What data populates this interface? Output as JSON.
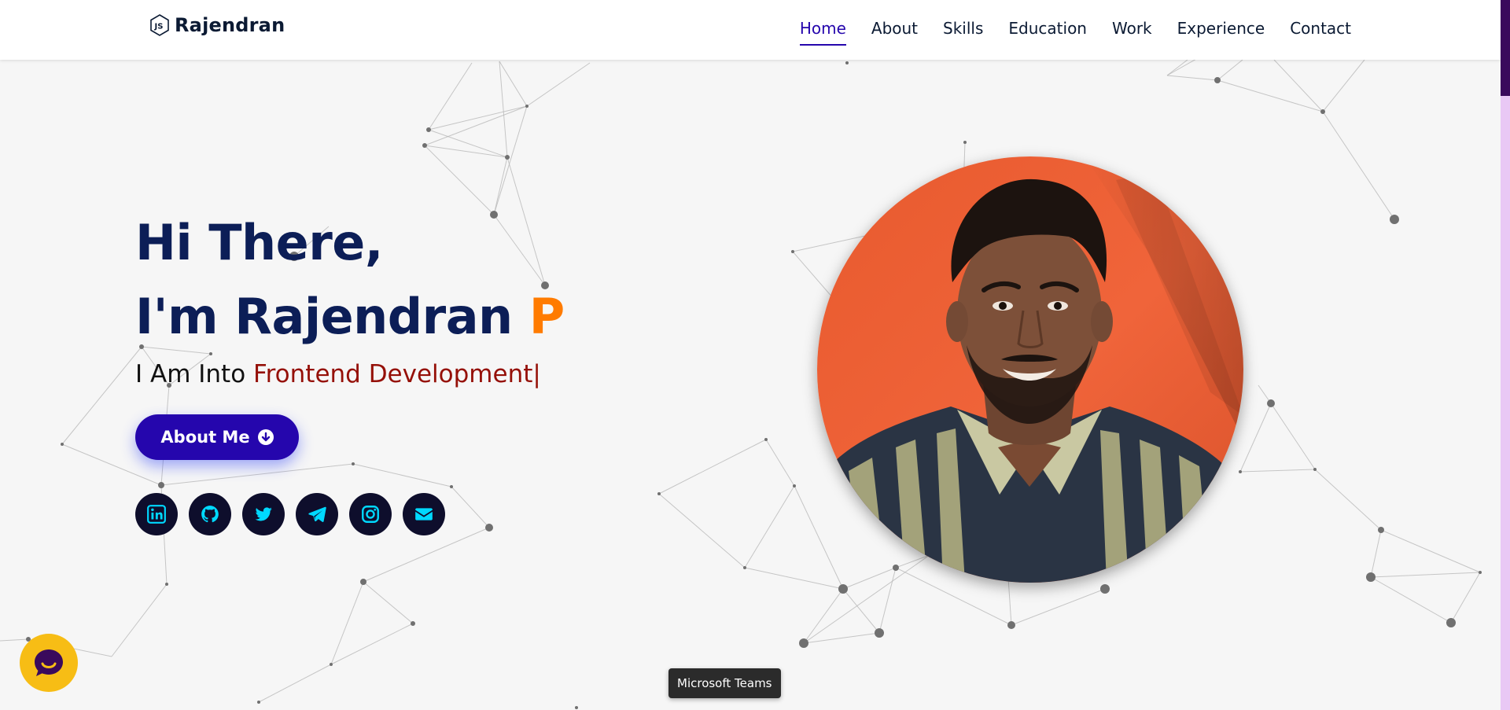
{
  "brand": {
    "name": "Rajendran",
    "icon": "node-js-icon"
  },
  "nav": {
    "items": [
      {
        "label": "Home",
        "active": true
      },
      {
        "label": "About",
        "active": false
      },
      {
        "label": "Skills",
        "active": false
      },
      {
        "label": "Education",
        "active": false
      },
      {
        "label": "Work",
        "active": false
      },
      {
        "label": "Experience",
        "active": false
      },
      {
        "label": "Contact",
        "active": false
      }
    ]
  },
  "hero": {
    "greeting": "Hi There,",
    "intro_prefix": "I'm Rajendran",
    "intro_highlight": "P",
    "tagline_prefix": "I Am Into",
    "typed_text": "Frontend Development",
    "caret": "|",
    "cta_label": "About Me",
    "cta_icon": "arrow-circle-down-icon"
  },
  "socials": [
    {
      "name": "linkedin",
      "icon": "linkedin-icon"
    },
    {
      "name": "github",
      "icon": "github-icon"
    },
    {
      "name": "twitter",
      "icon": "twitter-icon"
    },
    {
      "name": "telegram",
      "icon": "telegram-icon"
    },
    {
      "name": "instagram",
      "icon": "instagram-icon"
    },
    {
      "name": "email",
      "icon": "envelope-icon"
    }
  ],
  "chat_widget": {
    "icon": "chat-bubble-icon"
  },
  "tooltip": {
    "text": "Microsoft Teams"
  },
  "colors": {
    "primary": "#2506ad",
    "heading": "#0c1e57",
    "accent": "#ff7b00",
    "typed": "#951008",
    "social_bg": "#0e0e2c",
    "social_icon": "#00d9ff",
    "chat_bg": "#f7bd15",
    "page_bg": "#f6f6f6"
  }
}
